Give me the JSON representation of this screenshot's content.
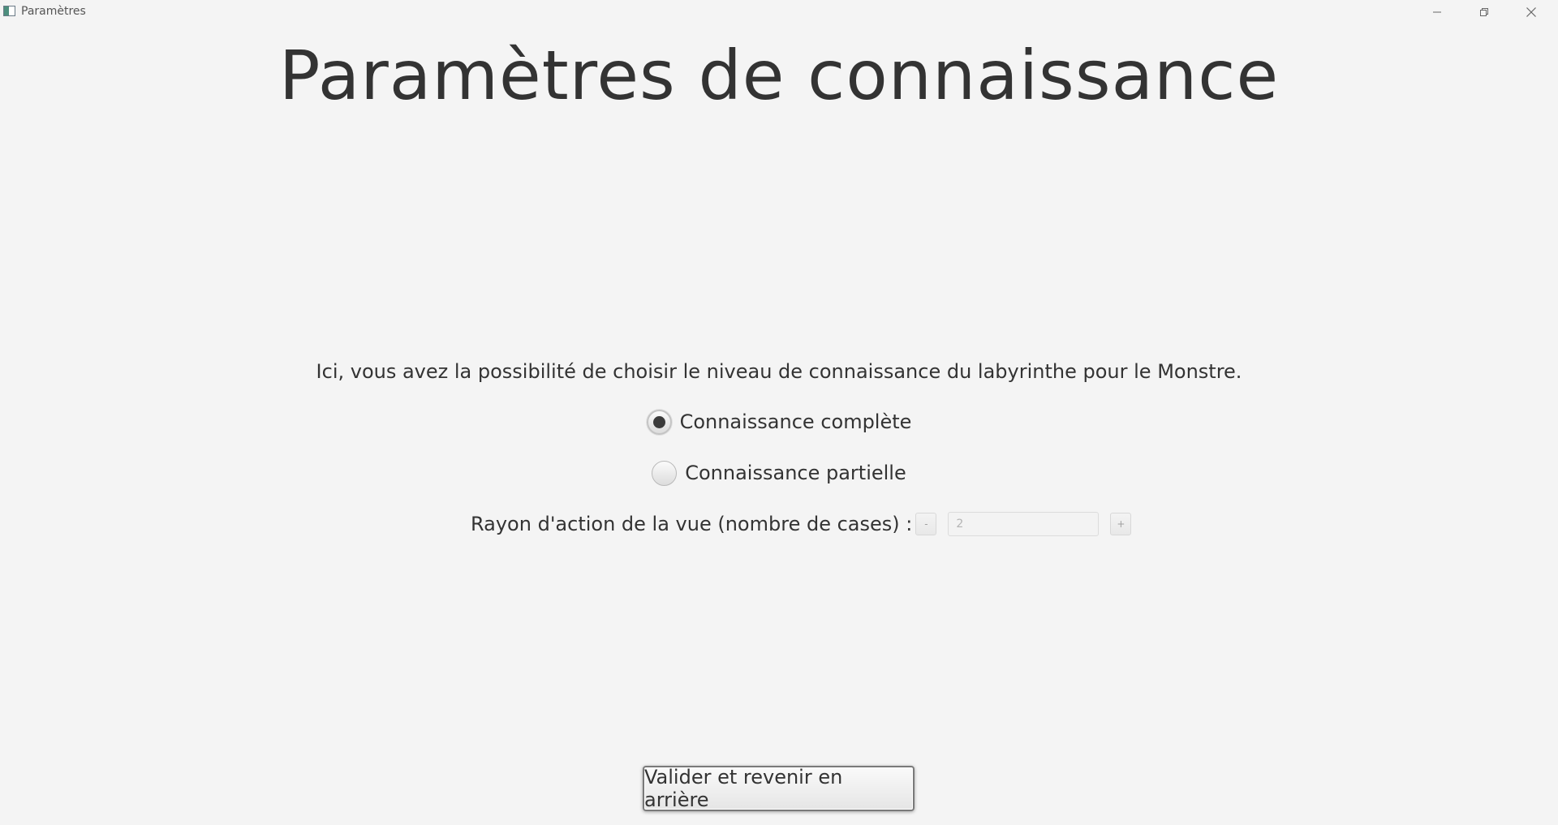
{
  "window": {
    "title": "Paramètres"
  },
  "page": {
    "heading": "Paramètres de connaissance",
    "description": "Ici, vous avez la possibilité de choisir le niveau de connaissance du labyrinthe pour le Monstre."
  },
  "knowledge": {
    "options": [
      {
        "label": "Connaissance complète",
        "selected": true
      },
      {
        "label": "Connaissance partielle",
        "selected": false
      }
    ]
  },
  "view_radius": {
    "label": "Rayon d'action de la vue (nombre de cases) :",
    "decrement_label": "-",
    "value": "2",
    "increment_label": "+",
    "enabled": false
  },
  "actions": {
    "validate_label": "Valider et revenir en arrière"
  },
  "icons": {
    "app": "app-window-icon",
    "minimize": "minimize-icon",
    "maximize": "restore-icon",
    "close": "close-icon"
  }
}
